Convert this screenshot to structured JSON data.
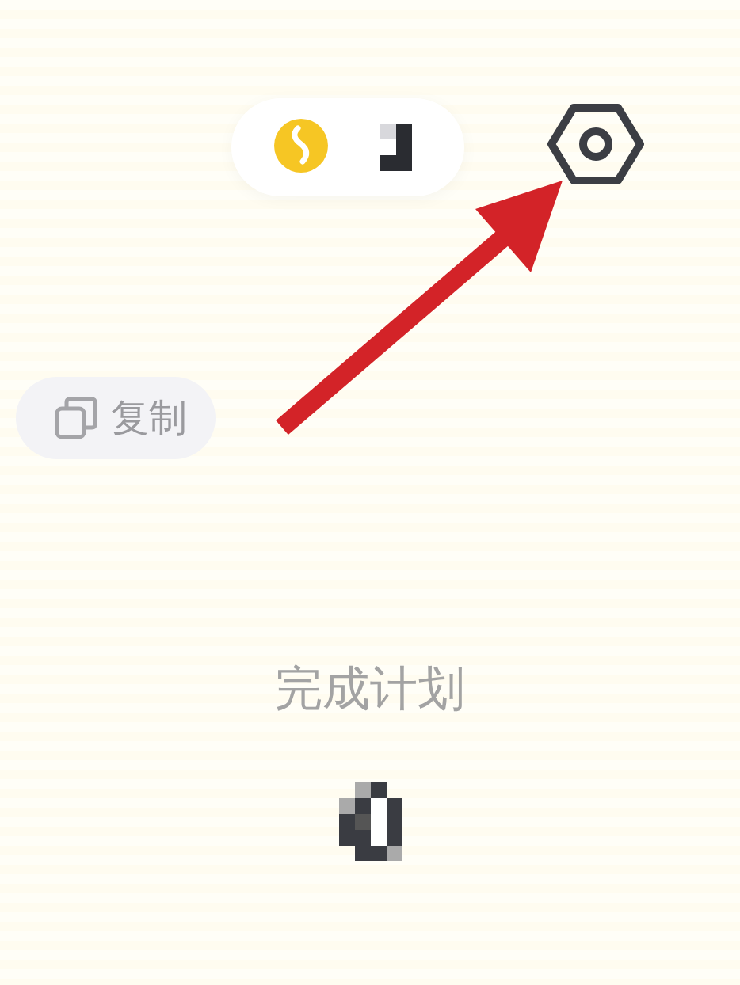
{
  "header": {
    "balance_pill": {
      "kind": "coin"
    },
    "settings_button": {
      "kind": "settings"
    }
  },
  "profile": {
    "copy_button": {
      "label": "复制"
    }
  },
  "stats": [
    {
      "label": "完成计划"
    }
  ]
}
